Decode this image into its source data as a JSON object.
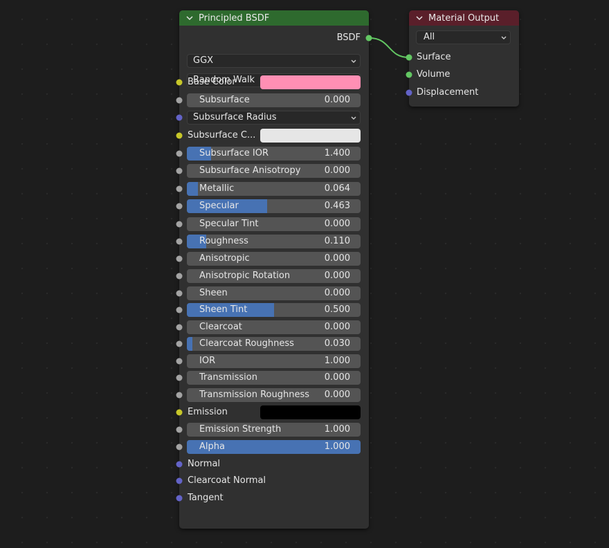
{
  "bsdf_node": {
    "title": "Principled BSDF",
    "output_label": "BSDF",
    "distribution": "GGX",
    "subsurface_method": "Random Walk",
    "inputs": [
      {
        "label": "Base Color",
        "type": "color",
        "color": "#ff8fb4",
        "socket": "yellow"
      },
      {
        "label": "Subsurface",
        "type": "slider",
        "value": "0.000",
        "fill": 0,
        "socket": "grey"
      },
      {
        "label": "Subsurface Radius",
        "type": "dropdown",
        "socket": "purple"
      },
      {
        "label": "Subsurface C...",
        "type": "color",
        "color": "#e6e6e6",
        "socket": "yellow"
      },
      {
        "label": "Subsurface IOR",
        "type": "slider",
        "value": "1.400",
        "fill": 0.14,
        "socket": "grey"
      },
      {
        "label": "Subsurface Anisotropy",
        "type": "slider",
        "value": "0.000",
        "fill": 0,
        "socket": "grey"
      },
      {
        "label": "Metallic",
        "type": "slider",
        "value": "0.064",
        "fill": 0.064,
        "socket": "grey"
      },
      {
        "label": "Specular",
        "type": "slider",
        "value": "0.463",
        "fill": 0.463,
        "socket": "grey"
      },
      {
        "label": "Specular Tint",
        "type": "slider",
        "value": "0.000",
        "fill": 0,
        "socket": "grey"
      },
      {
        "label": "Roughness",
        "type": "slider",
        "value": "0.110",
        "fill": 0.11,
        "socket": "grey"
      },
      {
        "label": "Anisotropic",
        "type": "slider",
        "value": "0.000",
        "fill": 0,
        "socket": "grey"
      },
      {
        "label": "Anisotropic Rotation",
        "type": "slider",
        "value": "0.000",
        "fill": 0,
        "socket": "grey"
      },
      {
        "label": "Sheen",
        "type": "slider",
        "value": "0.000",
        "fill": 0,
        "socket": "grey"
      },
      {
        "label": "Sheen Tint",
        "type": "slider",
        "value": "0.500",
        "fill": 0.5,
        "socket": "grey"
      },
      {
        "label": "Clearcoat",
        "type": "slider",
        "value": "0.000",
        "fill": 0,
        "socket": "grey"
      },
      {
        "label": "Clearcoat Roughness",
        "type": "slider",
        "value": "0.030",
        "fill": 0.03,
        "socket": "grey"
      },
      {
        "label": "IOR",
        "type": "slider",
        "value": "1.000",
        "fill": 0,
        "socket": "grey"
      },
      {
        "label": "Transmission",
        "type": "slider",
        "value": "0.000",
        "fill": 0,
        "socket": "grey"
      },
      {
        "label": "Transmission Roughness",
        "type": "slider",
        "value": "0.000",
        "fill": 0,
        "socket": "grey"
      },
      {
        "label": "Emission",
        "type": "color",
        "color": "#000000",
        "socket": "yellow"
      },
      {
        "label": "Emission Strength",
        "type": "slider",
        "value": "1.000",
        "fill": 0,
        "socket": "grey"
      },
      {
        "label": "Alpha",
        "type": "slider",
        "value": "1.000",
        "fill": 1,
        "socket": "grey"
      },
      {
        "label": "Normal",
        "type": "label",
        "socket": "purple"
      },
      {
        "label": "Clearcoat Normal",
        "type": "label",
        "socket": "purple"
      },
      {
        "label": "Tangent",
        "type": "label",
        "socket": "purple"
      }
    ]
  },
  "output_node": {
    "title": "Material Output",
    "target": "All",
    "inputs": [
      {
        "label": "Surface",
        "socket": "green"
      },
      {
        "label": "Volume",
        "socket": "green"
      },
      {
        "label": "Displacement",
        "socket": "purple"
      }
    ]
  },
  "colors": {
    "bsdf_header": "#2e6a2e",
    "output_header": "#5a1f2a",
    "slider_fill": "#4772b3",
    "link": "#63c763"
  }
}
